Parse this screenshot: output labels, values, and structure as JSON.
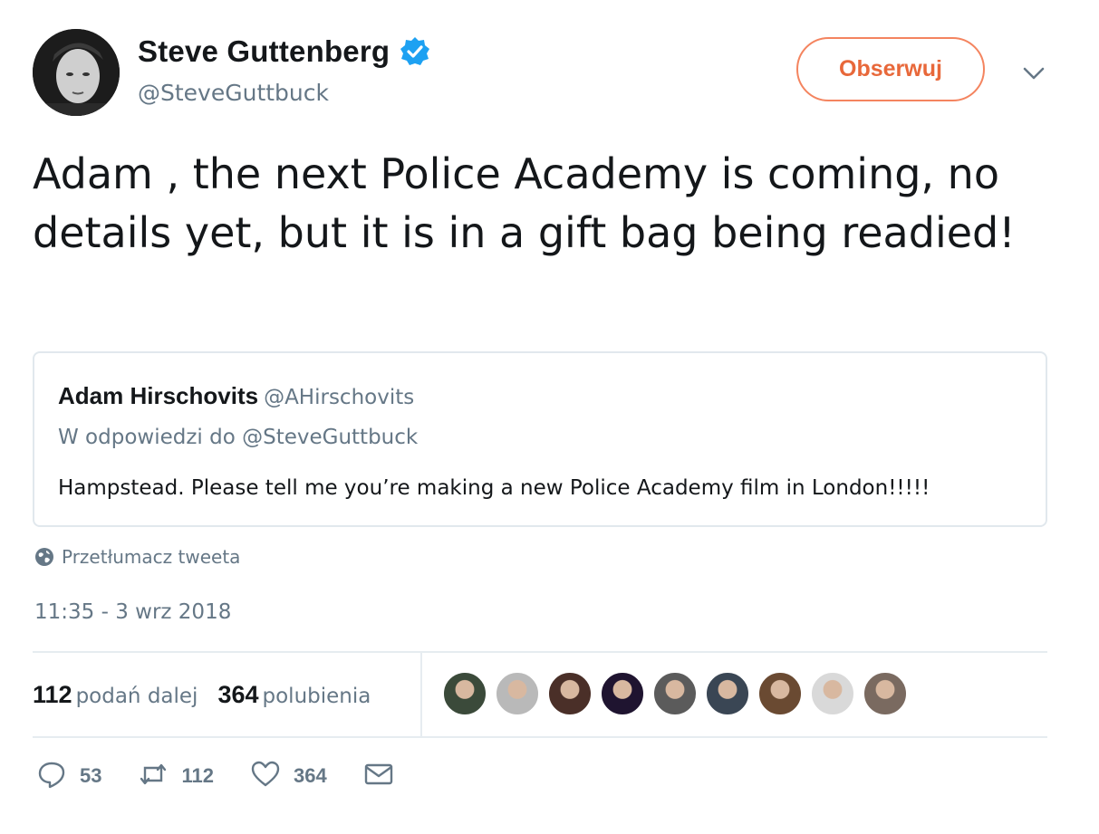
{
  "author": {
    "display_name": "Steve Guttenberg",
    "handle": "@SteveGuttbuck",
    "verified": true,
    "verified_color": "#1da1f2"
  },
  "follow_button": {
    "label": "Obserwuj",
    "color": "#e8683a"
  },
  "tweet": {
    "text": "Adam , the next Police Academy is coming, no details yet, but it is in a gift bag being readied!"
  },
  "quoted_tweet": {
    "author_name": "Adam Hirschovits",
    "author_handle": "@AHirschovits",
    "reply_to": "W odpowiedzi do @SteveGuttbuck",
    "text": "Hampstead. Please tell me you’re making a new Police Academy film in London!!!!!"
  },
  "translate_label": "Przetłumacz tweeta",
  "timestamp": "11:35 - 3 wrz 2018",
  "stats": {
    "retweets_count": "112",
    "retweets_label": "podań dalej",
    "likes_count": "364",
    "likes_label": "polubienia"
  },
  "actions": {
    "reply_count": "53",
    "retweet_count": "112",
    "like_count": "364"
  },
  "liker_avatars": [
    "#3b4a3a",
    "#b9b9b9",
    "#4a2f28",
    "#1f1430",
    "#5b5b5b",
    "#3a4654",
    "#6a4a32",
    "#d9d9d9",
    "#7a6a60"
  ]
}
